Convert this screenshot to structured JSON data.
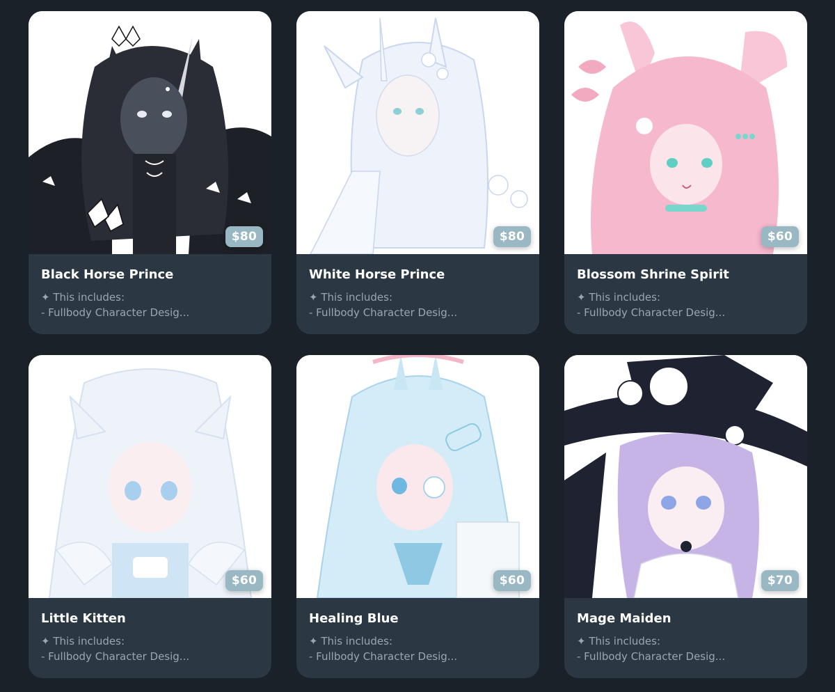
{
  "listings": [
    {
      "title": "Black Horse Prince",
      "price": "$80",
      "includes_label": "This includes:",
      "includes_line": "- Fullbody Character Desig...",
      "image_palette": {
        "bg": "#ffffff",
        "hair": "#2a2d36",
        "skin": "#4a4f5c",
        "accent": "#ffffff"
      }
    },
    {
      "title": "White Horse Prince",
      "price": "$80",
      "includes_label": "This includes:",
      "includes_line": "- Fullbody Character Desig...",
      "image_palette": {
        "bg": "#ffffff",
        "hair": "#e6edf8",
        "skin": "#f4f1f3",
        "accent": "#b8c8e6"
      }
    },
    {
      "title": "Blossom Shrine Spirit",
      "price": "$60",
      "includes_label": "This includes:",
      "includes_line": "- Fullbody Character Desig...",
      "image_palette": {
        "bg": "#ffffff",
        "hair": "#f6b8cc",
        "skin": "#fbe4ea",
        "accent": "#78d6cc"
      }
    },
    {
      "title": "Little Kitten",
      "price": "$60",
      "includes_label": "This includes:",
      "includes_line": "- Fullbody Character Desig...",
      "image_palette": {
        "bg": "#ffffff",
        "hair": "#eef3fa",
        "skin": "#fbeef0",
        "accent": "#a8d0ee"
      }
    },
    {
      "title": "Healing Blue",
      "price": "$60",
      "includes_label": "This includes:",
      "includes_line": "- Fullbody Character Desig...",
      "image_palette": {
        "bg": "#ffffff",
        "hair": "#c8e6f4",
        "skin": "#fbe8ec",
        "accent": "#8ec8e2"
      }
    },
    {
      "title": "Mage Maiden",
      "price": "$70",
      "includes_label": "This includes:",
      "includes_line": "- Fullbody Character Desig...",
      "image_palette": {
        "bg": "#ffffff",
        "hair": "#c7b4e6",
        "skin": "#fbeef2",
        "accent": "#1f2230"
      }
    }
  ],
  "icons": {
    "includes_marker": "sparkle-icon"
  },
  "colors": {
    "page_bg": "#1a2128",
    "card_bg": "#2b3843",
    "price_badge": "#9ab8c4",
    "title_text": "#ffffff",
    "desc_text": "#9aa6b0"
  }
}
